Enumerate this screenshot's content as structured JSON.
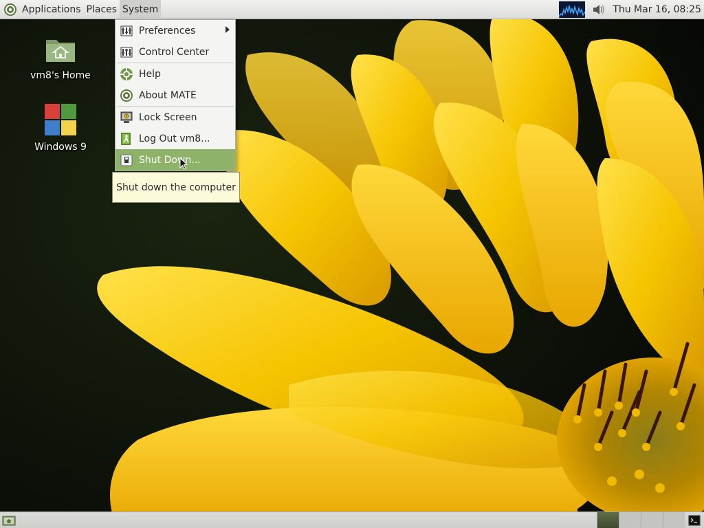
{
  "top_panel": {
    "menus": [
      "Applications",
      "Places",
      "System"
    ],
    "clock": "Thu Mar 16, 08:25"
  },
  "desktop": {
    "icons": [
      {
        "label": "vm8's Home",
        "icon": "home-folder-icon"
      },
      {
        "label": "Windows 9",
        "icon": "windows-logo-icon"
      }
    ]
  },
  "system_menu": {
    "items": [
      {
        "label": "Preferences",
        "icon": "preferences-icon",
        "submenu": true
      },
      {
        "label": "Control Center",
        "icon": "control-center-icon"
      },
      {
        "label": "Help",
        "icon": "help-icon"
      },
      {
        "label": "About MATE",
        "icon": "mate-logo-icon"
      },
      {
        "label": "Lock Screen",
        "icon": "lock-screen-icon"
      },
      {
        "label": "Log Out vm8...",
        "icon": "logout-icon"
      },
      {
        "label": "Shut Down...",
        "icon": "shutdown-icon",
        "highlighted": true
      }
    ]
  },
  "tooltip": {
    "text": "Shut down the computer"
  },
  "colors": {
    "menu_highlight": "#8fb26a",
    "tooltip_bg": "#fbfbd9",
    "panel_bg": "#dcdcda",
    "wallpaper_petal": "#f5c400"
  },
  "bottom_panel": {
    "workspaces": 4,
    "active_workspace": 1
  }
}
